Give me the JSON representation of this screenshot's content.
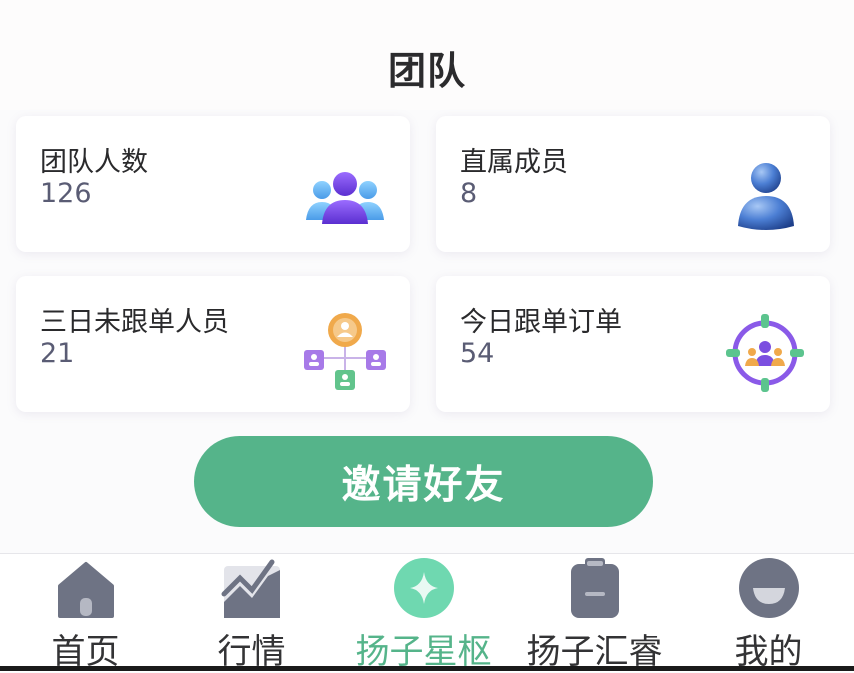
{
  "header": {
    "title": "团队"
  },
  "stats": [
    {
      "label": "团队人数",
      "value": "126",
      "icon": "team-group-icon"
    },
    {
      "label": "直属成员",
      "value": "8",
      "icon": "person-icon"
    },
    {
      "label": "三日未跟单人员",
      "value": "21",
      "icon": "org-chart-icon"
    },
    {
      "label": "今日跟单订单",
      "value": "54",
      "icon": "target-group-icon"
    }
  ],
  "invite_button": {
    "label": "邀请好友"
  },
  "tabbar": {
    "items": [
      {
        "label": "首页",
        "icon": "home-icon",
        "active": false
      },
      {
        "label": "行情",
        "icon": "trend-chart-icon",
        "active": false
      },
      {
        "label": "扬子星枢",
        "icon": "star-sparkle-icon",
        "active": true
      },
      {
        "label": "扬子汇睿",
        "icon": "clipboard-icon",
        "active": false
      },
      {
        "label": "我的",
        "icon": "profile-icon",
        "active": false
      }
    ]
  },
  "colors": {
    "accent": "#55b48a",
    "value_text": "#5a5c74",
    "tab_inactive_icon": "#6e7384",
    "icon_purple": "#7b4fe0",
    "icon_blue": "#3b6fc4"
  }
}
